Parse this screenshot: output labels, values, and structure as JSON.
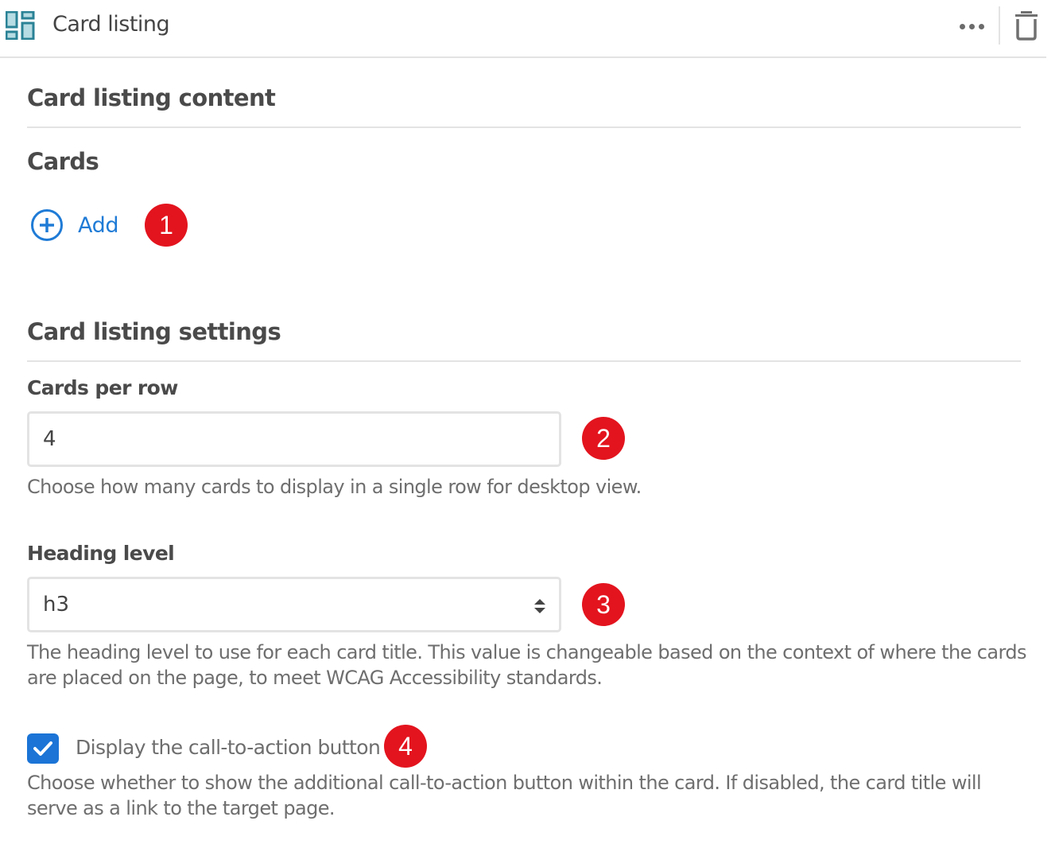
{
  "header": {
    "title": "Card listing",
    "icon": "card-grid-icon",
    "more_icon": "more-horizontal-icon",
    "delete_icon": "trash-icon"
  },
  "content_section": {
    "title": "Card listing content",
    "cards_label": "Cards",
    "add_label": "Add",
    "add_icon": "plus-circle-icon"
  },
  "settings_section": {
    "title": "Card listing settings",
    "cards_per_row": {
      "label": "Cards per row",
      "value": "4",
      "help": "Choose how many cards to display in a single row for desktop view."
    },
    "heading_level": {
      "label": "Heading level",
      "value": "h3",
      "help": "The heading level to use for each card title. This value is changeable based on the context of where the cards are placed on the page, to meet WCAG Accessibility standards."
    },
    "cta": {
      "label": "Display the call-to-action button",
      "checked": true,
      "help": "Choose whether to show the additional call-to-action button within the card. If disabled, the card title will serve as a link to the target page."
    }
  },
  "annotations": [
    "1",
    "2",
    "3",
    "4"
  ],
  "colors": {
    "accent": "#1f7bd6",
    "checkbox": "#1b74d6",
    "badge": "#e3141e",
    "icon_teal": "#2a8296",
    "divider": "#e3e3e3"
  }
}
